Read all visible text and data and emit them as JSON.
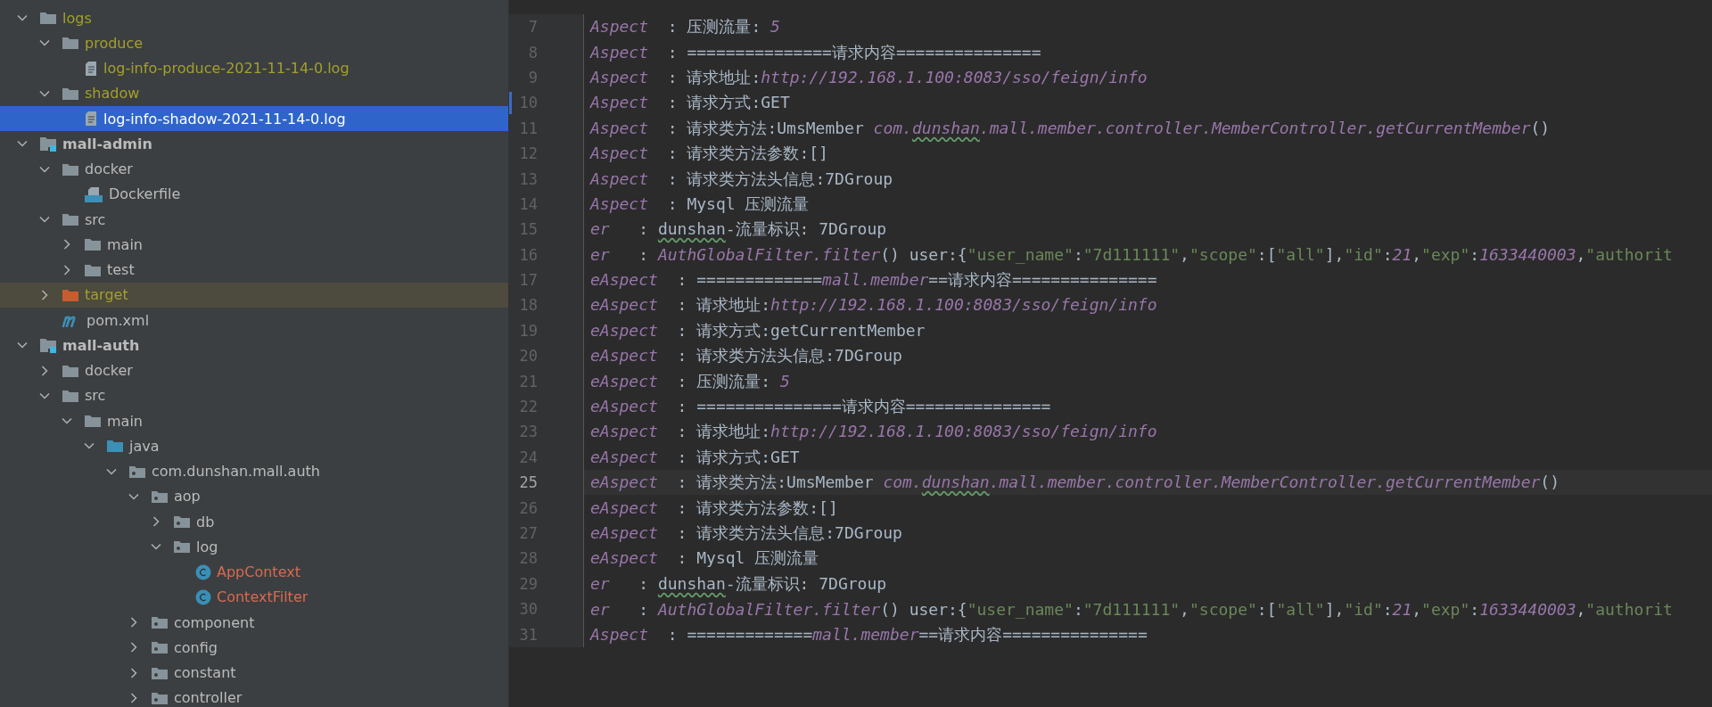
{
  "project_tree": {
    "items": [
      {
        "label": "logs",
        "kind": "folder",
        "color": "#a3a02b",
        "expanded": true,
        "selected": false,
        "children": [
          {
            "label": "produce",
            "kind": "folder",
            "color": "#a3a02b",
            "expanded": true,
            "selected": false,
            "children": [
              {
                "label": "log-info-produce-2021-11-14-0.log",
                "kind": "log-file",
                "color": "#a3a02b",
                "selected": false
              }
            ]
          },
          {
            "label": "shadow",
            "kind": "folder",
            "color": "#a3a02b",
            "expanded": true,
            "selected": false,
            "children": [
              {
                "label": "log-info-shadow-2021-11-14-0.log",
                "kind": "log-file",
                "color": "#ffffff",
                "selected": true
              }
            ]
          }
        ]
      },
      {
        "label": "mall-admin",
        "kind": "module",
        "color": "#bbbbbb",
        "expanded": true,
        "selected": false,
        "children": [
          {
            "label": "docker",
            "kind": "folder",
            "color": "#bbbbbb",
            "expanded": true,
            "selected": false,
            "children": [
              {
                "label": "Dockerfile",
                "kind": "dockerfile",
                "color": "#bbbbbb",
                "selected": false
              }
            ]
          },
          {
            "label": "src",
            "kind": "folder",
            "color": "#bbbbbb",
            "expanded": true,
            "selected": false,
            "children": [
              {
                "label": "main",
                "kind": "folder",
                "color": "#bbbbbb",
                "expanded": false,
                "selected": false
              },
              {
                "label": "test",
                "kind": "folder",
                "color": "#bbbbbb",
                "expanded": false,
                "selected": false
              }
            ]
          },
          {
            "label": "target",
            "kind": "excluded-folder",
            "color": "#a3a02b",
            "expanded": false,
            "selected": false
          },
          {
            "label": "pom.xml",
            "kind": "maven-file",
            "color": "#bbbbbb",
            "selected": false
          }
        ]
      },
      {
        "label": "mall-auth",
        "kind": "module",
        "color": "#bbbbbb",
        "expanded": true,
        "selected": false,
        "children": [
          {
            "label": "docker",
            "kind": "folder",
            "color": "#bbbbbb",
            "expanded": false,
            "selected": false
          },
          {
            "label": "src",
            "kind": "folder",
            "color": "#bbbbbb",
            "expanded": true,
            "selected": false,
            "children": [
              {
                "label": "main",
                "kind": "folder",
                "color": "#bbbbbb",
                "expanded": true,
                "selected": false,
                "children": [
                  {
                    "label": "java",
                    "kind": "source-folder",
                    "color": "#bbbbbb",
                    "expanded": true,
                    "selected": false,
                    "children": [
                      {
                        "label": "com.dunshan.mall.auth",
                        "kind": "package",
                        "color": "#bbbbbb",
                        "expanded": true,
                        "selected": false,
                        "children": [
                          {
                            "label": "aop",
                            "kind": "package",
                            "color": "#bbbbbb",
                            "expanded": true,
                            "selected": false,
                            "children": [
                              {
                                "label": "db",
                                "kind": "package",
                                "color": "#bbbbbb",
                                "expanded": false,
                                "selected": false
                              },
                              {
                                "label": "log",
                                "kind": "package",
                                "color": "#bbbbbb",
                                "expanded": true,
                                "selected": false,
                                "children": [
                                  {
                                    "label": "AppContext",
                                    "kind": "class",
                                    "color": "#d9694f",
                                    "selected": false
                                  },
                                  {
                                    "label": "ContextFilter",
                                    "kind": "class",
                                    "color": "#d9694f",
                                    "selected": false
                                  }
                                ]
                              }
                            ]
                          },
                          {
                            "label": "component",
                            "kind": "package",
                            "color": "#bbbbbb",
                            "expanded": false,
                            "selected": false
                          },
                          {
                            "label": "config",
                            "kind": "package",
                            "color": "#bbbbbb",
                            "expanded": false,
                            "selected": false
                          },
                          {
                            "label": "constant",
                            "kind": "package",
                            "color": "#bbbbbb",
                            "expanded": false,
                            "selected": false
                          },
                          {
                            "label": "controller",
                            "kind": "package",
                            "color": "#bbbbbb",
                            "expanded": false,
                            "selected": false
                          }
                        ]
                      }
                    ]
                  }
                ]
              }
            ]
          }
        ]
      }
    ]
  },
  "editor": {
    "lines": [
      {
        "number": "7",
        "current": false,
        "modified": false,
        "segments": [
          {
            "kind": "logger",
            "text": "Aspect"
          },
          {
            "kind": "plain",
            "text": "  : 压测流量: "
          },
          {
            "kind": "italic",
            "text": "5"
          }
        ]
      },
      {
        "number": "8",
        "current": false,
        "modified": false,
        "segments": [
          {
            "kind": "logger",
            "text": "Aspect"
          },
          {
            "kind": "plain",
            "text": "  : ===============请求内容==============="
          }
        ]
      },
      {
        "number": "9",
        "current": false,
        "modified": false,
        "segments": [
          {
            "kind": "logger",
            "text": "Aspect"
          },
          {
            "kind": "plain",
            "text": "  : 请求地址:"
          },
          {
            "kind": "italic",
            "text": "http://192.168.1.100:8083/sso/feign/info"
          }
        ]
      },
      {
        "number": "10",
        "current": false,
        "modified": true,
        "segments": [
          {
            "kind": "logger",
            "text": "Aspect"
          },
          {
            "kind": "plain",
            "text": "  : 请求方式:GET"
          }
        ]
      },
      {
        "number": "11",
        "current": false,
        "modified": false,
        "segments": [
          {
            "kind": "logger",
            "text": "Aspect"
          },
          {
            "kind": "plain",
            "text": "  : 请求类方法:UmsMember "
          },
          {
            "kind": "italic",
            "text": "com."
          },
          {
            "kind": "italic-typo",
            "text": "dunshan"
          },
          {
            "kind": "italic",
            "text": ".mall.member.controller.MemberController.getCurrentMember"
          },
          {
            "kind": "plain",
            "text": "()"
          }
        ]
      },
      {
        "number": "12",
        "current": false,
        "modified": false,
        "segments": [
          {
            "kind": "logger",
            "text": "Aspect"
          },
          {
            "kind": "plain",
            "text": "  : 请求类方法参数:[]"
          }
        ]
      },
      {
        "number": "13",
        "current": false,
        "modified": false,
        "segments": [
          {
            "kind": "logger",
            "text": "Aspect"
          },
          {
            "kind": "plain",
            "text": "  : 请求类方法头信息:7DGroup"
          }
        ]
      },
      {
        "number": "14",
        "current": false,
        "modified": false,
        "segments": [
          {
            "kind": "logger",
            "text": "Aspect"
          },
          {
            "kind": "plain",
            "text": "  : Mysql 压测流量"
          }
        ]
      },
      {
        "number": "15",
        "current": false,
        "modified": false,
        "segments": [
          {
            "kind": "logger",
            "text": "er"
          },
          {
            "kind": "plain",
            "text": "   : "
          },
          {
            "kind": "typo",
            "text": "dunshan"
          },
          {
            "kind": "plain",
            "text": "-流量标识: 7DGroup"
          }
        ]
      },
      {
        "number": "16",
        "current": false,
        "modified": false,
        "segments": [
          {
            "kind": "logger",
            "text": "er"
          },
          {
            "kind": "plain",
            "text": "   : "
          },
          {
            "kind": "italic",
            "text": "AuthGlobalFilter.filter"
          },
          {
            "kind": "plain",
            "text": "() user:{"
          },
          {
            "kind": "string",
            "text": "\"user_name\""
          },
          {
            "kind": "plain",
            "text": ":"
          },
          {
            "kind": "string",
            "text": "\"7d111111\""
          },
          {
            "kind": "plain",
            "text": ","
          },
          {
            "kind": "string",
            "text": "\"scope\""
          },
          {
            "kind": "plain",
            "text": ":["
          },
          {
            "kind": "string",
            "text": "\"all\""
          },
          {
            "kind": "plain",
            "text": "],"
          },
          {
            "kind": "string",
            "text": "\"id\""
          },
          {
            "kind": "plain",
            "text": ":"
          },
          {
            "kind": "italic",
            "text": "21"
          },
          {
            "kind": "plain",
            "text": ","
          },
          {
            "kind": "string",
            "text": "\"exp\""
          },
          {
            "kind": "plain",
            "text": ":"
          },
          {
            "kind": "italic",
            "text": "1633440003"
          },
          {
            "kind": "plain",
            "text": ","
          },
          {
            "kind": "string",
            "text": "\"authorit"
          }
        ]
      },
      {
        "number": "17",
        "current": false,
        "modified": false,
        "segments": [
          {
            "kind": "logger",
            "text": "eAspect"
          },
          {
            "kind": "plain",
            "text": "  : ============="
          },
          {
            "kind": "italic",
            "text": "mall.member"
          },
          {
            "kind": "plain",
            "text": "==请求内容==============="
          }
        ]
      },
      {
        "number": "18",
        "current": false,
        "modified": false,
        "segments": [
          {
            "kind": "logger",
            "text": "eAspect"
          },
          {
            "kind": "plain",
            "text": "  : 请求地址:"
          },
          {
            "kind": "italic",
            "text": "http://192.168.1.100:8083/sso/feign/info"
          }
        ]
      },
      {
        "number": "19",
        "current": false,
        "modified": false,
        "segments": [
          {
            "kind": "logger",
            "text": "eAspect"
          },
          {
            "kind": "plain",
            "text": "  : 请求方式:getCurrentMember"
          }
        ]
      },
      {
        "number": "20",
        "current": false,
        "modified": false,
        "segments": [
          {
            "kind": "logger",
            "text": "eAspect"
          },
          {
            "kind": "plain",
            "text": "  : 请求类方法头信息:7DGroup"
          }
        ]
      },
      {
        "number": "21",
        "current": false,
        "modified": false,
        "segments": [
          {
            "kind": "logger",
            "text": "eAspect"
          },
          {
            "kind": "plain",
            "text": "  : 压测流量: "
          },
          {
            "kind": "italic",
            "text": "5"
          }
        ]
      },
      {
        "number": "22",
        "current": false,
        "modified": false,
        "segments": [
          {
            "kind": "logger",
            "text": "eAspect"
          },
          {
            "kind": "plain",
            "text": "  : ===============请求内容==============="
          }
        ]
      },
      {
        "number": "23",
        "current": false,
        "modified": false,
        "segments": [
          {
            "kind": "logger",
            "text": "eAspect"
          },
          {
            "kind": "plain",
            "text": "  : 请求地址:"
          },
          {
            "kind": "italic",
            "text": "http://192.168.1.100:8083/sso/feign/info"
          }
        ]
      },
      {
        "number": "24",
        "current": false,
        "modified": false,
        "segments": [
          {
            "kind": "logger",
            "text": "eAspect"
          },
          {
            "kind": "plain",
            "text": "  : 请求方式:GET"
          }
        ]
      },
      {
        "number": "25",
        "current": true,
        "modified": false,
        "segments": [
          {
            "kind": "logger",
            "text": "eAspect"
          },
          {
            "kind": "plain",
            "text": "  : 请求类方法:UmsMember "
          },
          {
            "kind": "italic",
            "text": "com."
          },
          {
            "kind": "italic-typo",
            "text": "dunshan"
          },
          {
            "kind": "italic",
            "text": ".mall.member.controller.MemberController.getCurrentMember"
          },
          {
            "kind": "plain",
            "text": "()"
          }
        ]
      },
      {
        "number": "26",
        "current": false,
        "modified": false,
        "segments": [
          {
            "kind": "logger",
            "text": "eAspect"
          },
          {
            "kind": "plain",
            "text": "  : 请求类方法参数:[]"
          }
        ]
      },
      {
        "number": "27",
        "current": false,
        "modified": false,
        "segments": [
          {
            "kind": "logger",
            "text": "eAspect"
          },
          {
            "kind": "plain",
            "text": "  : 请求类方法头信息:7DGroup"
          }
        ]
      },
      {
        "number": "28",
        "current": false,
        "modified": false,
        "segments": [
          {
            "kind": "logger",
            "text": "eAspect"
          },
          {
            "kind": "plain",
            "text": "  : Mysql 压测流量"
          }
        ]
      },
      {
        "number": "29",
        "current": false,
        "modified": false,
        "segments": [
          {
            "kind": "logger",
            "text": "er"
          },
          {
            "kind": "plain",
            "text": "   : "
          },
          {
            "kind": "typo",
            "text": "dunshan"
          },
          {
            "kind": "plain",
            "text": "-流量标识: 7DGroup"
          }
        ]
      },
      {
        "number": "30",
        "current": false,
        "modified": false,
        "segments": [
          {
            "kind": "logger",
            "text": "er"
          },
          {
            "kind": "plain",
            "text": "   : "
          },
          {
            "kind": "italic",
            "text": "AuthGlobalFilter.filter"
          },
          {
            "kind": "plain",
            "text": "() user:{"
          },
          {
            "kind": "string",
            "text": "\"user_name\""
          },
          {
            "kind": "plain",
            "text": ":"
          },
          {
            "kind": "string",
            "text": "\"7d111111\""
          },
          {
            "kind": "plain",
            "text": ","
          },
          {
            "kind": "string",
            "text": "\"scope\""
          },
          {
            "kind": "plain",
            "text": ":["
          },
          {
            "kind": "string",
            "text": "\"all\""
          },
          {
            "kind": "plain",
            "text": "],"
          },
          {
            "kind": "string",
            "text": "\"id\""
          },
          {
            "kind": "plain",
            "text": ":"
          },
          {
            "kind": "italic",
            "text": "21"
          },
          {
            "kind": "plain",
            "text": ","
          },
          {
            "kind": "string",
            "text": "\"exp\""
          },
          {
            "kind": "plain",
            "text": ":"
          },
          {
            "kind": "italic",
            "text": "1633440003"
          },
          {
            "kind": "plain",
            "text": ","
          },
          {
            "kind": "string",
            "text": "\"authorit"
          }
        ]
      },
      {
        "number": "31",
        "current": false,
        "modified": false,
        "segments": [
          {
            "kind": "logger",
            "text": "Aspect"
          },
          {
            "kind": "plain",
            "text": "  : ============="
          },
          {
            "kind": "italic",
            "text": "mall.member"
          },
          {
            "kind": "plain",
            "text": "==请求内容==============="
          }
        ]
      }
    ]
  }
}
